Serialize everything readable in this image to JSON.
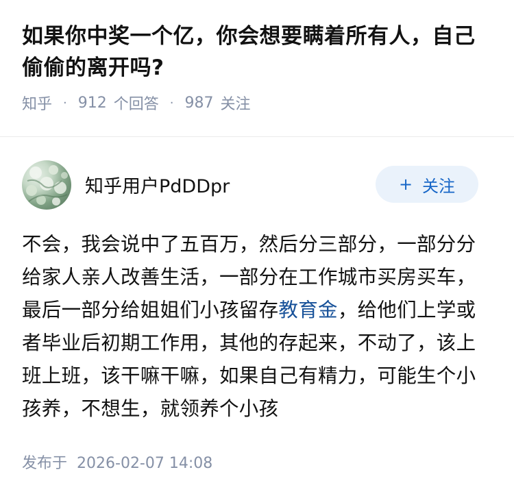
{
  "question": {
    "title": "如果你中奖一个亿，你会想要瞒着所有人，自己偷偷的离开吗?",
    "source": "知乎",
    "answer_count": "912",
    "answer_label": "个回答",
    "follower_count": "987",
    "follower_label": "关注",
    "separator": "·"
  },
  "answer": {
    "author": {
      "name": "知乎用户PdDDpr",
      "avatar_icon": "avatar-image"
    },
    "follow_button": {
      "plus": "+",
      "label": "关注"
    },
    "body_before_link": "不会，我会说中了五百万，然后分三部分，一部分分给家人亲人改善生活，一部分在工作城市买房买车，最后一部分给姐姐们小孩留存",
    "body_link": "教育金",
    "body_after_link": "，给他们上学或者毕业后初期工作用，其他的存起来，不动了，该上班上班，该干嘛干嘛，如果自己有精力，可能生个小孩养，不想生，就领养个小孩",
    "publish_label": "发布于",
    "publish_date": "2026-02-07 14:08"
  },
  "colors": {
    "link": "#175199",
    "meta": "#8590a6",
    "follow_bg": "#eaf2fb",
    "follow_text": "#1766c7"
  }
}
